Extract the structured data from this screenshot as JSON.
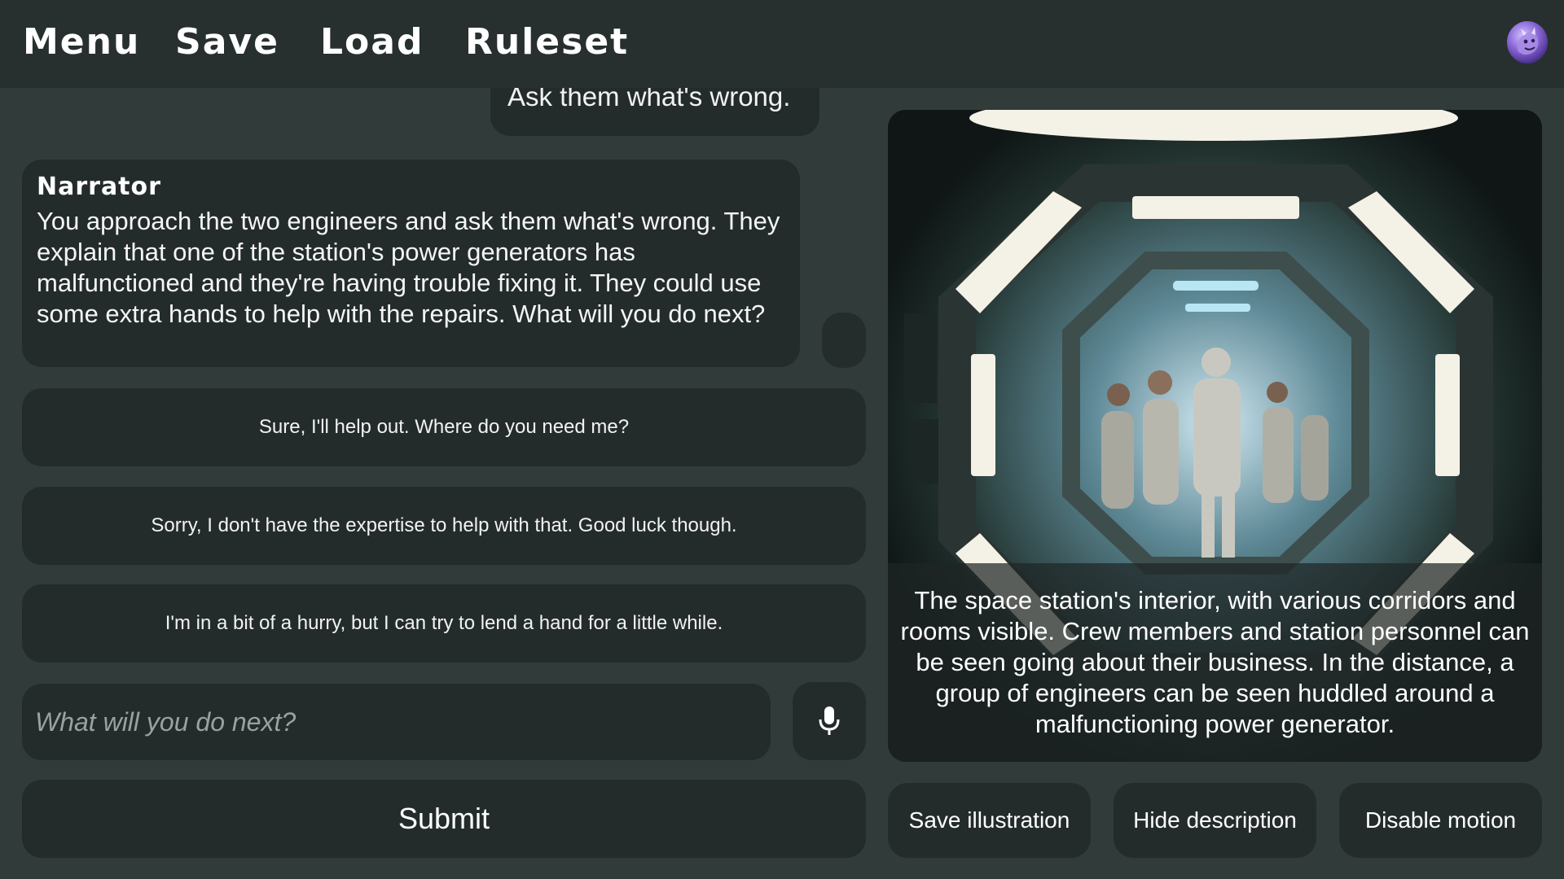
{
  "topbar": {
    "menu": "Menu",
    "save": "Save",
    "load": "Load",
    "ruleset": "Ruleset"
  },
  "chat": {
    "user_message": "Ask them what's wrong.",
    "narrator": {
      "name": "Narrator",
      "text": "You approach the two engineers and ask them what's wrong. They explain that one of the station's power generators has malfunctioned and they're having trouble fixing it. They could use some extra hands to help with the repairs. What will you do next?"
    },
    "choices": [
      "Sure, I'll help out. Where do you need me?",
      "Sorry, I don't have the expertise to help with that. Good luck though.",
      "I'm in a bit of a hurry, but I can try to lend a hand for a little while."
    ],
    "input_placeholder": "What will you do next?",
    "submit_label": "Submit"
  },
  "illustration": {
    "description": "The space station's interior, with various corridors and rooms visible. Crew members and station personnel can be seen going about their business. In the distance, a group of engineers can be seen huddled around a malfunctioning power generator."
  },
  "actions": {
    "save_illustration": "Save illustration",
    "hide_description": "Hide description",
    "disable_motion": "Disable motion"
  },
  "colors": {
    "background": "#313c3a",
    "topbar": "#28302f",
    "card": "#242c2b"
  }
}
